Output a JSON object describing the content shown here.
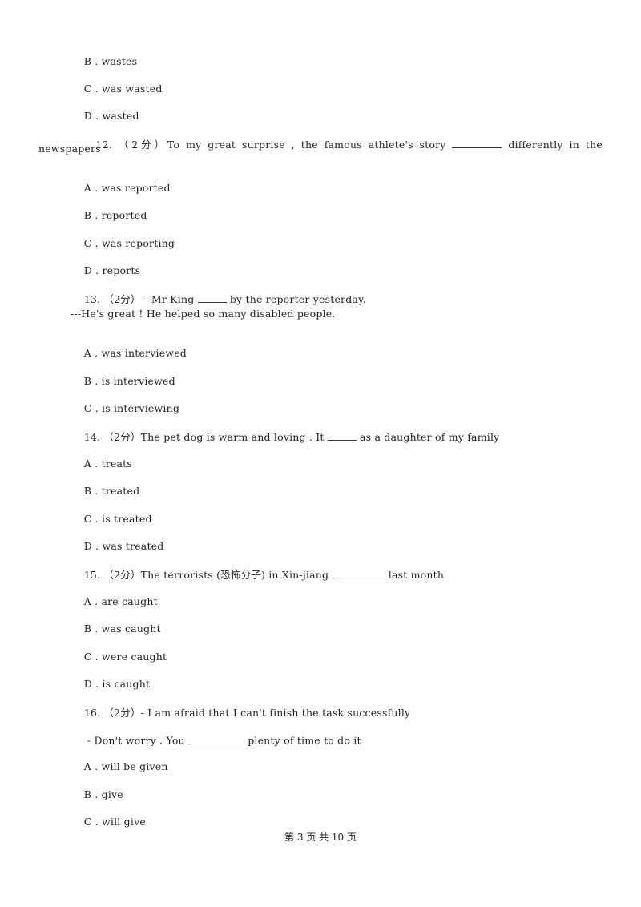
{
  "prev_question": {
    "options": [
      {
        "letter": "B",
        "text": "wastes"
      },
      {
        "letter": "C",
        "text": "was wasted"
      },
      {
        "letter": "D",
        "text": "wasted"
      }
    ]
  },
  "questions": [
    {
      "number": "12.",
      "score": "（2分）",
      "stem_before": "To my great surprise , the famous athlete's story",
      "stem_after": "differently in the",
      "stem_cont": "newspapers",
      "options": [
        {
          "letter": "A",
          "text": "was reported"
        },
        {
          "letter": "B",
          "text": "reported"
        },
        {
          "letter": "C",
          "text": "was reporting"
        },
        {
          "letter": "D",
          "text": "reports"
        }
      ]
    },
    {
      "number": "13.",
      "score": "（2分）",
      "stem_before": "---Mr King",
      "stem_after": "by the reporter yesterday.",
      "stem_line2": "---He's great ! He helped so many disabled people.",
      "options": [
        {
          "letter": "A",
          "text": "was interviewed"
        },
        {
          "letter": "B",
          "text": "is interviewed"
        },
        {
          "letter": "C",
          "text": "is interviewing"
        }
      ]
    },
    {
      "number": "14.",
      "score": "（2分）",
      "stem_before": "The pet dog is warm and loving . It",
      "stem_after": "as a daughter of my family",
      "options": [
        {
          "letter": "A",
          "text": "treats"
        },
        {
          "letter": "B",
          "text": "treated"
        },
        {
          "letter": "C",
          "text": "is treated"
        },
        {
          "letter": "D",
          "text": "was treated"
        }
      ]
    },
    {
      "number": "15.",
      "score": "（2分）",
      "stem_before": "The terrorists (恐怖分子) in Xin-jiang ",
      "stem_after": "last month",
      "options": [
        {
          "letter": "A",
          "text": "are caught"
        },
        {
          "letter": "B",
          "text": "was caught"
        },
        {
          "letter": "C",
          "text": "were caught"
        },
        {
          "letter": "D",
          "text": "is caught"
        }
      ]
    },
    {
      "number": "16.",
      "score": "（2分）",
      "stem_before": "- I am afraid that I can't finish the task successfully",
      "stem_line2_before": " - Don't worry . You",
      "stem_line2_after": "plenty of time to do it",
      "options": [
        {
          "letter": "A",
          "text": "will be given"
        },
        {
          "letter": "B",
          "text": "give"
        },
        {
          "letter": "C",
          "text": "will give"
        }
      ]
    }
  ],
  "footer": {
    "text": "第 3 页 共 10 页"
  }
}
